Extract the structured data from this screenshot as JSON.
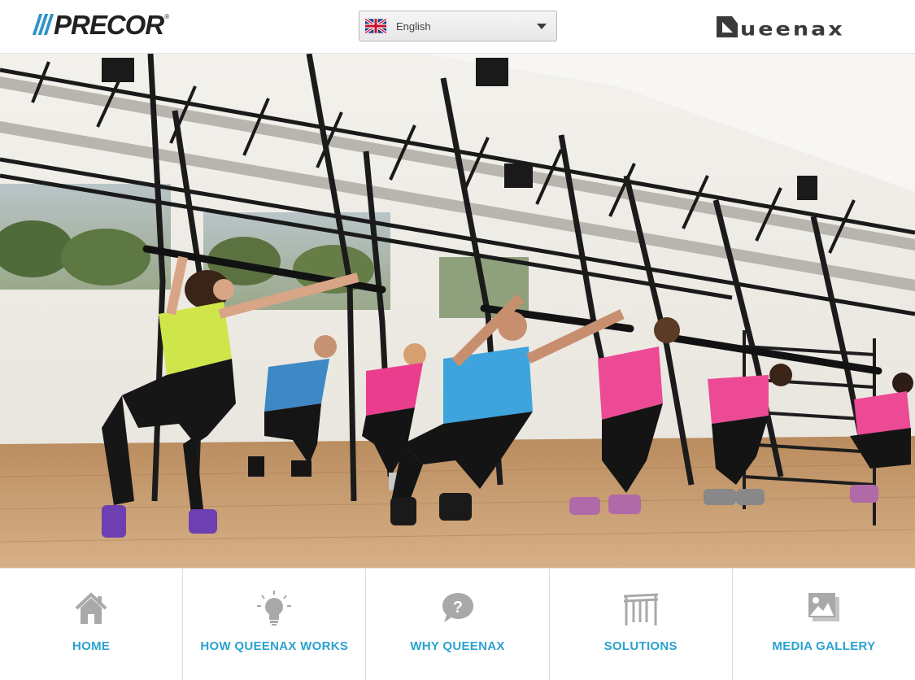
{
  "header": {
    "brand_left": "PRECOR",
    "brand_right": "ueenax",
    "language": {
      "selected": "English",
      "flag": "uk-flag-icon"
    }
  },
  "nav": {
    "items": [
      {
        "label": "HOME",
        "icon": "home-icon"
      },
      {
        "label": "HOW QUEENAX WORKS",
        "icon": "lightbulb-icon"
      },
      {
        "label": "WHY QUEENAX",
        "icon": "question-bubble-icon"
      },
      {
        "label": "SOLUTIONS",
        "icon": "gym-frame-icon"
      },
      {
        "label": "MEDIA GALLERY",
        "icon": "photo-gallery-icon"
      }
    ]
  },
  "colors": {
    "accent": "#2aa2cf",
    "precor_blue": "#2f93c8",
    "logo_dark": "#222222"
  }
}
